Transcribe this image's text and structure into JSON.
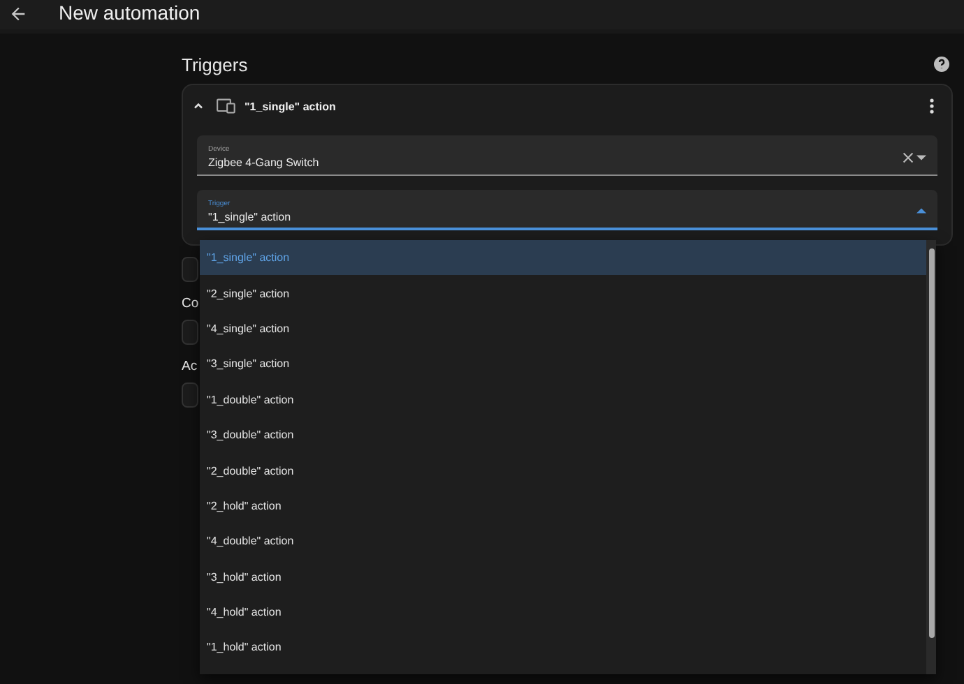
{
  "window": {
    "title": "New automation"
  },
  "triggers": {
    "title": "Triggers",
    "card": {
      "title": "\"1_single\" action",
      "expanded": true,
      "device": {
        "label": "Device",
        "value": "Zigbee 4-Gang Switch"
      },
      "trigger": {
        "label": "Trigger",
        "value": "\"1_single\" action",
        "open": true
      }
    }
  },
  "sections": [
    {
      "title": "Co"
    },
    {
      "title": "Ac"
    }
  ],
  "options": [
    {
      "label": "\"1_single\" action",
      "selected": true
    },
    {
      "label": "\"2_single\" action",
      "selected": false
    },
    {
      "label": "\"4_single\" action",
      "selected": false
    },
    {
      "label": "\"3_single\" action",
      "selected": false
    },
    {
      "label": "\"1_double\" action",
      "selected": false
    },
    {
      "label": "\"3_double\" action",
      "selected": false
    },
    {
      "label": "\"2_double\" action",
      "selected": false
    },
    {
      "label": "\"2_hold\" action",
      "selected": false
    },
    {
      "label": "\"4_double\" action",
      "selected": false
    },
    {
      "label": "\"3_hold\" action",
      "selected": false
    },
    {
      "label": "\"4_hold\" action",
      "selected": false
    },
    {
      "label": "\"1_hold\" action",
      "selected": false
    }
  ]
}
